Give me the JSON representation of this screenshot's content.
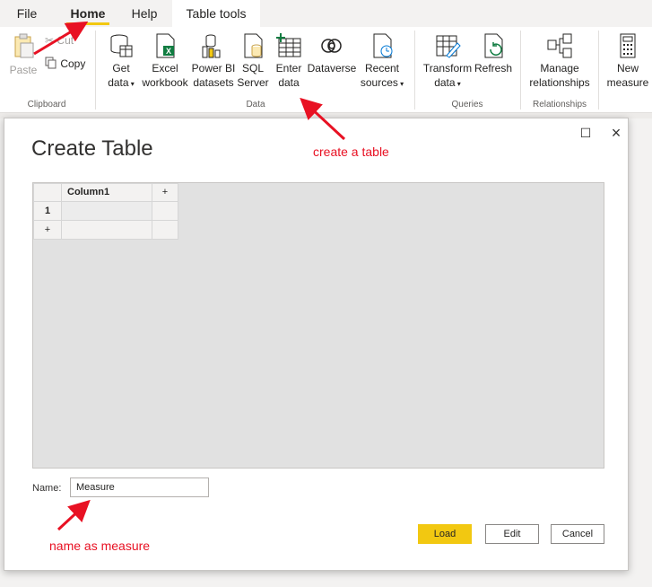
{
  "tabs": [
    {
      "label": "File"
    },
    {
      "label": "Home"
    },
    {
      "label": "Help"
    },
    {
      "label": "Table tools"
    }
  ],
  "ribbon": {
    "clipboard": {
      "paste": "Paste",
      "cut": "Cut",
      "copy": "Copy",
      "group": "Clipboard"
    },
    "data": {
      "get_data": [
        "Get",
        "data"
      ],
      "excel": [
        "Excel",
        "workbook"
      ],
      "pbi": [
        "Power BI",
        "datasets"
      ],
      "sql": [
        "SQL",
        "Server"
      ],
      "enter": [
        "Enter",
        "data"
      ],
      "dataverse": [
        "Dataverse"
      ],
      "recent": [
        "Recent",
        "sources"
      ],
      "group": "Data"
    },
    "queries": {
      "transform": [
        "Transform",
        "data"
      ],
      "refresh": [
        "Refresh"
      ],
      "group": "Queries"
    },
    "relationships": {
      "manage": [
        "Manage",
        "relationships"
      ],
      "group": "Relationships"
    },
    "calc": {
      "new_measure": [
        "New",
        "measure"
      ]
    }
  },
  "dialog": {
    "title": "Create Table",
    "grid": {
      "column_header": "Column1",
      "add_col": "+",
      "row1": "1",
      "add_row": "+"
    },
    "name_label": "Name:",
    "name_value": "Measure",
    "load": "Load",
    "edit": "Edit",
    "cancel": "Cancel"
  },
  "annotations": {
    "create_table": "create a table",
    "name_as_measure": "name as measure"
  },
  "colors": {
    "accent": "#f2c811",
    "annotation": "#e81123"
  }
}
